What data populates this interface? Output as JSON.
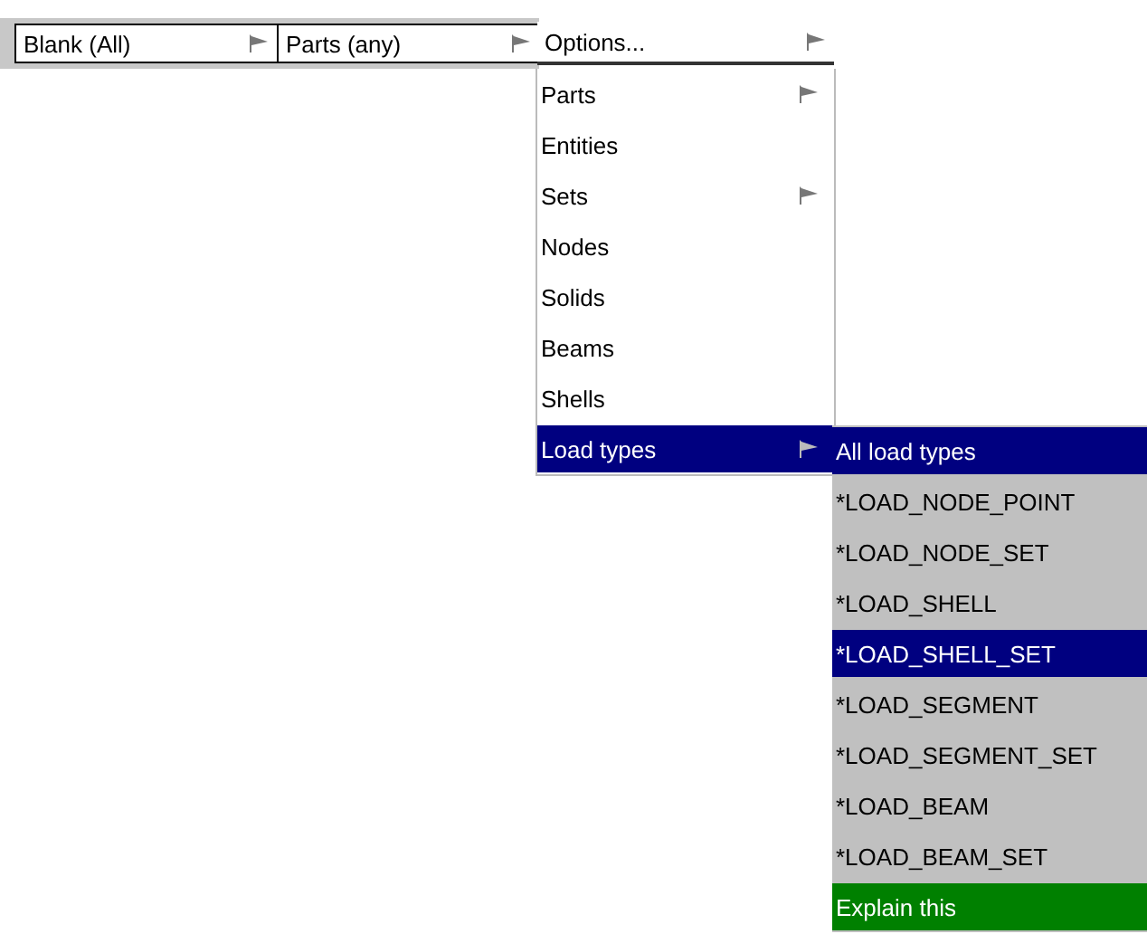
{
  "toolbar": {
    "buttons": [
      {
        "label": "Blank (All)",
        "has_arrow": true
      },
      {
        "label": "Parts (any)",
        "has_arrow": true
      }
    ],
    "options": {
      "label": "Options...",
      "has_arrow": true
    }
  },
  "menu": {
    "items": [
      {
        "label": "Parts",
        "has_submenu": true,
        "selected": false
      },
      {
        "label": "Entities",
        "has_submenu": false,
        "selected": false
      },
      {
        "label": "Sets",
        "has_submenu": true,
        "selected": false
      },
      {
        "label": "Nodes",
        "has_submenu": false,
        "selected": false
      },
      {
        "label": "Solids",
        "has_submenu": false,
        "selected": false
      },
      {
        "label": "Beams",
        "has_submenu": false,
        "selected": false
      },
      {
        "label": "Shells",
        "has_submenu": false,
        "selected": false
      },
      {
        "label": "Load types",
        "has_submenu": true,
        "selected": true
      }
    ]
  },
  "submenu": {
    "items": [
      {
        "label": "All load types",
        "kind": "item",
        "selected": true
      },
      {
        "label": "*LOAD_NODE_POINT",
        "kind": "item",
        "selected": false
      },
      {
        "label": "*LOAD_NODE_SET",
        "kind": "item",
        "selected": false
      },
      {
        "label": "*LOAD_SHELL",
        "kind": "item",
        "selected": false
      },
      {
        "label": "*LOAD_SHELL_SET",
        "kind": "item",
        "selected": true
      },
      {
        "label": "*LOAD_SEGMENT",
        "kind": "item",
        "selected": false
      },
      {
        "label": "*LOAD_SEGMENT_SET",
        "kind": "item",
        "selected": false
      },
      {
        "label": "*LOAD_BEAM",
        "kind": "item",
        "selected": false
      },
      {
        "label": "*LOAD_BEAM_SET",
        "kind": "item",
        "selected": false
      },
      {
        "label": "Explain this",
        "kind": "help",
        "selected": false
      }
    ]
  }
}
